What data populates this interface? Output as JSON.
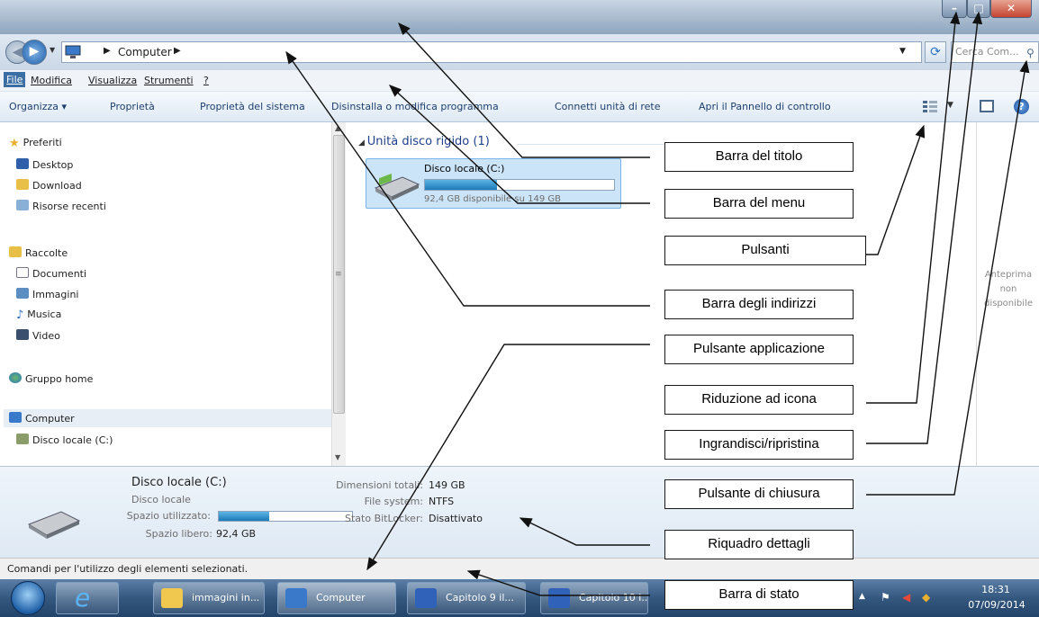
{
  "address_bar": {
    "location": "Computer",
    "search_placeholder": "Cerca Com..."
  },
  "menu_bar": {
    "items": [
      "File",
      "Modifica",
      "Visualizza",
      "Strumenti",
      "?"
    ]
  },
  "command_bar": {
    "organizza": "Organizza ▾",
    "proprieta": "Proprietà",
    "proprieta_sistema": "Proprietà del sistema",
    "disinstalla": "Disinstalla o modifica programma",
    "connetti": "Connetti unità di rete",
    "pannello": "Apri il Pannello di controllo"
  },
  "nav_pane": {
    "preferiti": "Preferiti",
    "desktop": "Desktop",
    "download": "Download",
    "risorse_recenti": "Risorse recenti",
    "raccolte": "Raccolte",
    "documenti": "Documenti",
    "immagini": "Immagini",
    "musica": "Musica",
    "video": "Video",
    "gruppo_home": "Gruppo home",
    "computer": "Computer",
    "disco_locale": "Disco locale (C:)"
  },
  "content": {
    "group_header": "Unità disco rigido (1)",
    "drive_name": "Disco locale (C:)",
    "drive_free_text": "92,4 GB disponibile su 149 GB",
    "drive_used_fraction": 0.38
  },
  "preview_pane": {
    "line1": "Anteprima",
    "line2": "non",
    "line3": "disponibile"
  },
  "details": {
    "name": "Disco locale (C:)",
    "type": "Disco locale",
    "used_label": "Spazio utilizzato:",
    "free_label": "Spazio libero:",
    "free_value": "92,4 GB",
    "total_label": "Dimensioni totali:",
    "total_value": "149 GB",
    "fs_label": "File system:",
    "fs_value": "NTFS",
    "bitlocker_label": "Stato BitLocker:",
    "bitlocker_value": "Disattivato"
  },
  "status_bar": {
    "text": "Comandi per l'utilizzo degli elementi selezionati."
  },
  "taskbar": {
    "folder_label": "immagini in...",
    "computer_label": "Computer",
    "cap9_label": "Capitolo 9 il...",
    "cap10_label": "Capitolo 10 i...",
    "time": "18:31",
    "date": "07/09/2014"
  },
  "annotations": {
    "titolo": "Barra del titolo",
    "menu": "Barra del menu",
    "pulsanti": "Pulsanti",
    "indirizzi": "Barra degli indirizzi",
    "applicazione": "Pulsante applicazione",
    "riduzione": "Riduzione ad icona",
    "ingrandisci": "Ingrandisci/ripristina",
    "chiusura": "Pulsante di chiusura",
    "dettagli": "Riquadro dettagli",
    "stato": "Barra di stato"
  },
  "colors": {
    "titlebar": "#aebfd1",
    "accent_blue": "#1b7ab8",
    "close_red": "#c44331",
    "taskbar": "#34577f"
  }
}
